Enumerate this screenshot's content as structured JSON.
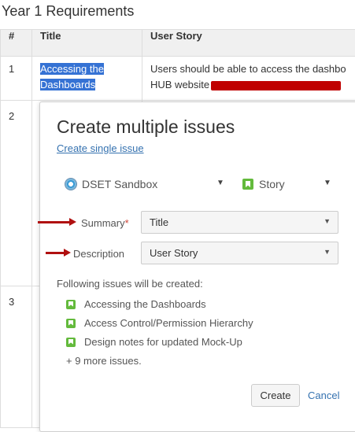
{
  "page": {
    "title": "Year 1 Requirements"
  },
  "table": {
    "headers": [
      "#",
      "Title",
      "User Story"
    ],
    "rows": [
      {
        "num": "1",
        "title": "Accessing the Dashboards",
        "story_line1": "Users should be able to access the dashbo",
        "story_line2": "HUB website"
      },
      {
        "num": "2"
      },
      {
        "num": "3"
      }
    ]
  },
  "dialog": {
    "title": "Create multiple issues",
    "single_link": "Create single issue",
    "project": "DSET Sandbox",
    "issue_type": "Story",
    "summary_label": "Summary",
    "summary_value": "Title",
    "description_label": "Description",
    "description_value": "User Story",
    "following_text": "Following issues will be created:",
    "issues": [
      "Accessing the Dashboards",
      "Access Control/Permission Hierarchy",
      "Design notes for updated Mock-Up"
    ],
    "more_text": "+ 9 more issues.",
    "create_label": "Create",
    "cancel_label": "Cancel"
  },
  "colors": {
    "link": "#3572b0",
    "highlight": "#3572d4",
    "arrow": "#b01010",
    "story_icon": "#63ba3c"
  }
}
